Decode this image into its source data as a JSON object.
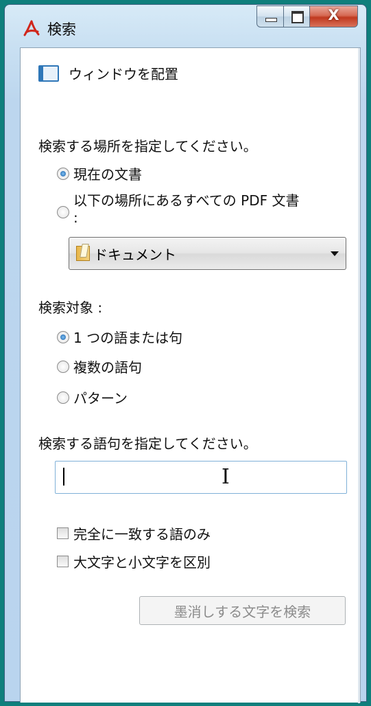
{
  "window": {
    "title": "検索",
    "close_glyph": "X"
  },
  "dock": {
    "label": "ウィンドウを配置"
  },
  "location": {
    "heading": "検索する場所を指定してください。",
    "options": [
      {
        "label": "現在の文書",
        "checked": true
      },
      {
        "label": "以下の場所にあるすべての PDF 文書",
        "label_cont": ":",
        "checked": false
      }
    ],
    "folder": {
      "selected": "ドキュメント"
    }
  },
  "target": {
    "heading": "検索対象 :",
    "options": [
      {
        "label": "1 つの語または句",
        "checked": true
      },
      {
        "label": "複数の語句",
        "checked": false
      },
      {
        "label": "パターン",
        "checked": false
      }
    ]
  },
  "query": {
    "heading": "検索する語句を指定してください。",
    "value": ""
  },
  "checkboxes": [
    {
      "label": "完全に一致する語のみ",
      "checked": false
    },
    {
      "label": "大文字と小文字を区別",
      "checked": false
    }
  ],
  "redact_button": {
    "label": "墨消しする文字を検索"
  }
}
